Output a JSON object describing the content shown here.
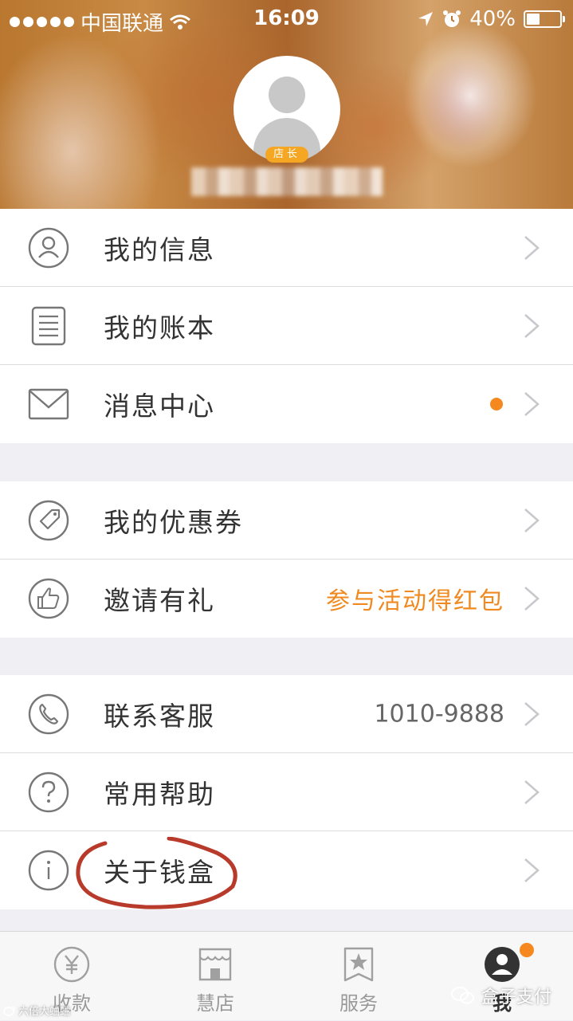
{
  "status_bar": {
    "carrier": "中国联通",
    "time": "16:09",
    "battery": "40%",
    "battery_level": 0.4,
    "icons": [
      "signal-dots-icon",
      "wifi-icon",
      "location-arrow-icon",
      "alarm-icon",
      "battery-icon"
    ]
  },
  "profile": {
    "role_badge": "店长",
    "avatar_icon": "default-avatar-icon"
  },
  "groups": [
    {
      "items": [
        {
          "label": "我的信息",
          "icon": "user-circle-icon"
        },
        {
          "label": "我的账本",
          "icon": "ledger-icon"
        },
        {
          "label": "消息中心",
          "icon": "envelope-icon",
          "badge_dot": true
        }
      ]
    },
    {
      "items": [
        {
          "label": "我的优惠券",
          "icon": "tag-icon"
        },
        {
          "label": "邀请有礼",
          "icon": "thumbs-up-icon",
          "value": "参与活动得红包"
        }
      ]
    },
    {
      "items": [
        {
          "label": "联系客服",
          "icon": "phone-icon",
          "value": "1010-9888"
        },
        {
          "label": "常用帮助",
          "icon": "question-icon"
        },
        {
          "label": "关于钱盒",
          "icon": "info-icon"
        }
      ]
    }
  ],
  "tabbar": {
    "tabs": [
      {
        "label": "收款",
        "icon": "yen-icon"
      },
      {
        "label": "慧店",
        "icon": "shop-icon"
      },
      {
        "label": "服务",
        "icon": "star-bookmark-icon"
      },
      {
        "label": "我",
        "icon": "profile-icon",
        "active": true,
        "badge_dot": true
      }
    ]
  },
  "watermarks": {
    "right": "盒子支付",
    "left": "六倍大蛐蛐"
  },
  "colors": {
    "accent": "#f5891f",
    "badge": "#f5a623",
    "annotation": "#c0392b"
  }
}
